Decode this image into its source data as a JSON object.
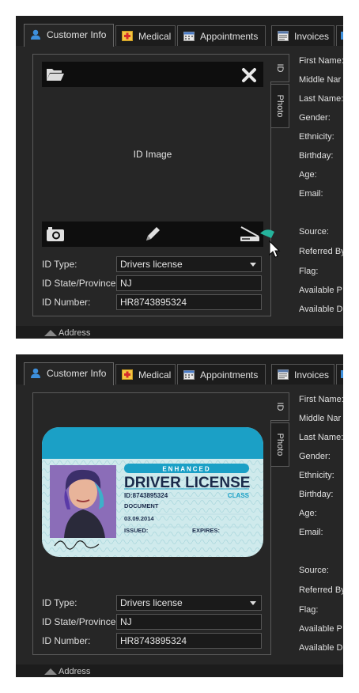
{
  "tabs": [
    {
      "label": "Customer Info",
      "icon": "person-icon",
      "active": true
    },
    {
      "label": "Medical",
      "icon": "medical-kit-icon"
    },
    {
      "label": "Appointments",
      "icon": "calendar-icon"
    },
    {
      "label": "Invoices",
      "icon": "invoice-icon"
    }
  ],
  "id_panel": {
    "side_tabs": [
      "ID",
      "Photo"
    ],
    "image_placeholder": "ID Image",
    "fields": [
      {
        "label": "ID Type:",
        "value": "Drivers license",
        "dropdown": true
      },
      {
        "label": "ID State/Province:",
        "value": "NJ"
      },
      {
        "label": "ID Number:",
        "value": "HR8743895324"
      }
    ]
  },
  "customer_fields": [
    "First Name:",
    "Middle Nar",
    "Last Name:",
    "Gender:",
    "Ethnicity:",
    "Birthday:",
    "Age:",
    "Email:",
    "Source:",
    "Referred By",
    "Flag:",
    "Available P",
    "Available D"
  ],
  "section_below": "Address",
  "license_card": {
    "badge": "ENHANCED",
    "title": "DRIVER LICENSE",
    "id_line": "ID:8743895324",
    "class_label": "CLASS",
    "document_label": "DOCUMENT",
    "date": "03.09.2014",
    "issued_label": "ISSUED:",
    "expires_label": "EXPIRES:"
  },
  "colors": {
    "accent": "#3da0d8",
    "teal": "#25b39c",
    "background": "#262626"
  }
}
